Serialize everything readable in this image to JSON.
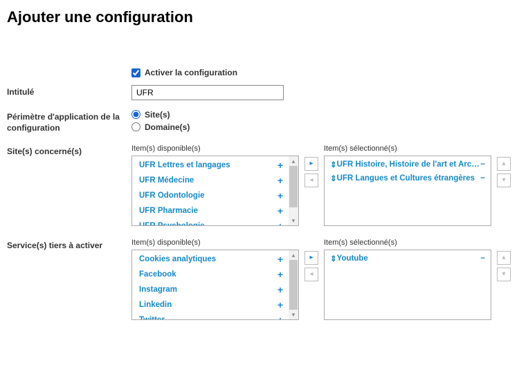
{
  "title": "Ajouter une configuration",
  "activate_label": "Activer la configuration",
  "intitule_label": "Intitulé",
  "intitule_value": "UFR",
  "scope_label": "Périmètre d'application de la configuration",
  "scope_site": "Site(s)",
  "scope_domain": "Domaine(s)",
  "sites_label": "Site(s) concerné(s)",
  "services_label": "Service(s) tiers à activer",
  "available_header": "Item(s) disponible(s)",
  "selected_header": "Item(s) sélectionné(s)",
  "sites_available": [
    "UFR Lettres et langages",
    "UFR Médecine",
    "UFR Odontologie",
    "UFR Pharmacie",
    "UFR Psychologie"
  ],
  "sites_selected": [
    "UFR Histoire, Histoire de l'art et Arché…",
    "UFR Langues et Cultures étrangères"
  ],
  "services_available": [
    "Cookies analytiques",
    "Facebook",
    "Instagram",
    "Linkedin",
    "Twitter"
  ],
  "services_selected": [
    "Youtube"
  ]
}
